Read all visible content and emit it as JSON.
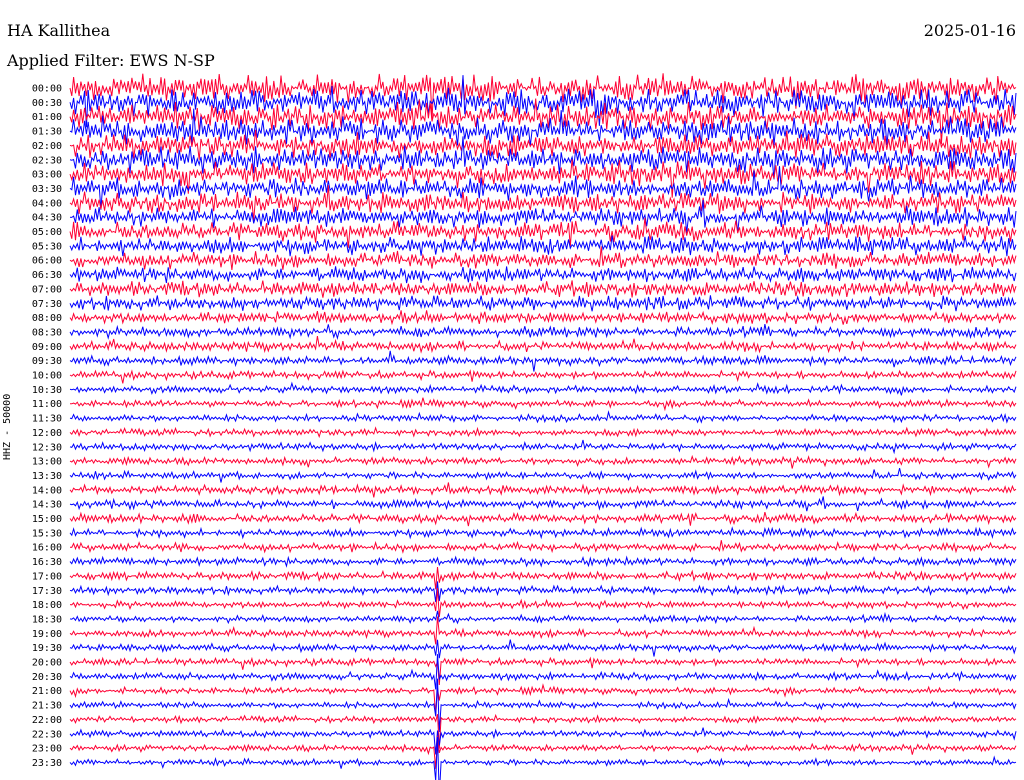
{
  "header": {
    "station": "HA Kallithea",
    "date": "2025-01-16",
    "filter": "Applied Filter: EWS N-SP",
    "channel": "HHZ - 50000"
  },
  "chart_data": {
    "type": "line",
    "title": "HA Kallithea",
    "subtitle": "Applied Filter: EWS N-SP",
    "date": "2025-01-16",
    "ylabel": "HHZ - 50000",
    "rows": [
      "00:00",
      "00:30",
      "01:00",
      "01:30",
      "02:00",
      "02:30",
      "03:00",
      "03:30",
      "04:00",
      "04:30",
      "05:00",
      "05:30",
      "06:00",
      "06:30",
      "07:00",
      "07:30",
      "08:00",
      "08:30",
      "09:00",
      "09:30",
      "10:00",
      "10:30",
      "11:00",
      "11:30",
      "12:00",
      "12:30",
      "13:00",
      "13:30",
      "14:00",
      "14:30",
      "15:00",
      "15:30",
      "16:00",
      "16:30",
      "17:00",
      "17:30",
      "18:00",
      "18:30",
      "19:00",
      "19:30",
      "20:00",
      "20:30",
      "21:00",
      "21:30",
      "22:00",
      "22:30",
      "23:00",
      "23:30"
    ],
    "colors": [
      "#ff0033",
      "#0000ff"
    ],
    "noise_level": [
      1.0,
      1.0,
      0.95,
      0.95,
      0.9,
      0.9,
      0.85,
      0.8,
      0.7,
      0.7,
      0.65,
      0.62,
      0.55,
      0.52,
      0.5,
      0.45,
      0.35,
      0.3,
      0.25,
      0.22,
      0.18,
      0.15,
      0.15,
      0.15,
      0.15,
      0.15,
      0.16,
      0.16,
      0.2,
      0.22,
      0.22,
      0.2,
      0.2,
      0.2,
      0.2,
      0.18,
      0.15,
      0.14,
      0.15,
      0.15,
      0.15,
      0.15,
      0.13,
      0.12,
      0.12,
      0.12,
      0.12,
      0.12
    ],
    "grid": false
  }
}
